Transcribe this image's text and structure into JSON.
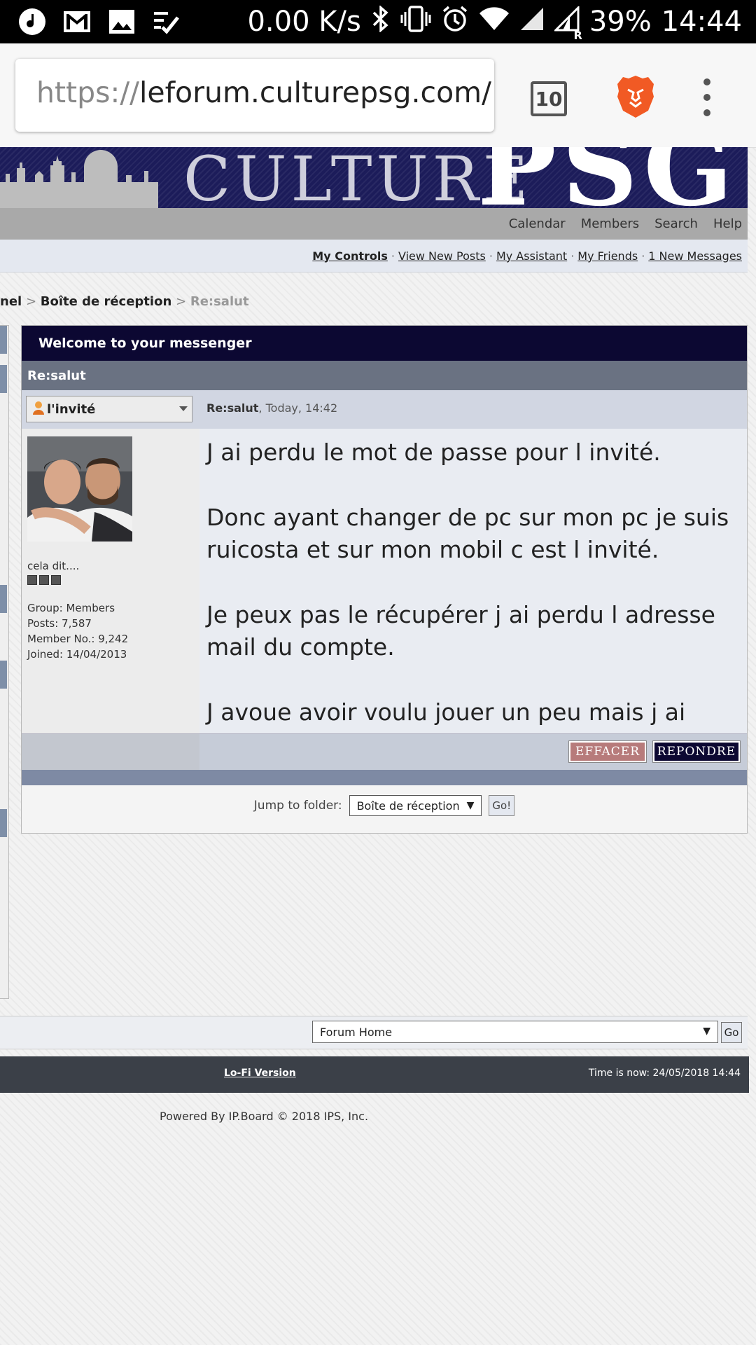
{
  "status_bar": {
    "speed": "0.00 K/s",
    "battery": "39%",
    "time": "14:44",
    "icons": [
      "music-icon",
      "gmail-icon",
      "gallery-icon",
      "checklist-icon",
      "bluetooth-icon",
      "vibrate-icon",
      "alarm-icon",
      "wifi-icon",
      "signal-icon",
      "signal-roaming-icon"
    ],
    "roaming": "R"
  },
  "browser": {
    "url_scheme": "https://",
    "url_host": "leforum.culturepsg.com/",
    "tab_count": "10"
  },
  "banner": {
    "word1": "CULTURE",
    "word2": "PSG",
    "color": "#1c1c5a"
  },
  "nav": {
    "items": [
      "Calendar",
      "Members",
      "Search",
      "Help"
    ]
  },
  "userlinks": {
    "items": [
      "My Controls",
      "View New Posts",
      "My Assistant",
      "My Friends",
      "1 New Messages"
    ],
    "sep": "·"
  },
  "breadcrumb": {
    "part1": "nel",
    "part2": "Boîte de réception",
    "current": "Re:salut",
    "sep": ">"
  },
  "messenger": {
    "header": "Welcome to your messenger",
    "subject": "Re:salut",
    "header_color": "#0c0832",
    "post": {
      "author": "l'invité",
      "meta_title": "Re:salut",
      "meta_date": ", Today, 14:42",
      "author_title": "cela dit....",
      "group": "Group: Members",
      "posts": "Posts: 7,587",
      "member_no": "Member No.: 9,242",
      "joined": "Joined: 14/04/2013",
      "paragraphs": [
        "J ai perdu le mot de passe pour l invité.",
        "Donc ayant changer de pc sur mon pc je suis ruicosta et sur mon mobil c est l invité.",
        "Je peux pas le récupérer j ai perdu l adresse mail du compte.",
        "J avoue avoir voulu jouer un peu mais j ai perdu."
      ]
    },
    "delete_label": "EFFACER",
    "reply_label": "REPONDRE",
    "jump_label": "Jump to folder:",
    "jump_value": "Boîte de réception",
    "jump_go": "Go!"
  },
  "bottom": {
    "forum_select": "Forum Home",
    "forum_go": "Go",
    "lofi": "Lo-Fi Version",
    "time_now": "Time is now: 24/05/2018 14:44",
    "powered": "Powered By IP.Board © 2018  IPS, Inc."
  }
}
